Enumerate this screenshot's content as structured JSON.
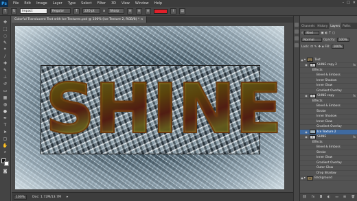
{
  "app": {
    "logo": "Ps",
    "menu": [
      "File",
      "Edit",
      "Image",
      "Layer",
      "Type",
      "Select",
      "Filter",
      "3D",
      "View",
      "Window",
      "Help"
    ],
    "window_controls": [
      "–",
      "□",
      "✕"
    ]
  },
  "options": {
    "font_family": "Impact",
    "font_style": "Regular",
    "font_size": "220 pt",
    "aa_label": "a",
    "antialias": "Sharp"
  },
  "document": {
    "tab_title": "Colorful Translucent Text with Ice Textures.psd @ 100% (Ice Texture 2, RGB/8) *",
    "text": [
      "S",
      "H",
      "I",
      "N",
      "E"
    ],
    "zoom": "100%",
    "doc_size": "Doc: 1.72M/13.7M"
  },
  "panels": {
    "tabs": [
      "Channels",
      "History",
      "Layers",
      "Paths"
    ],
    "active_tab": "Layers",
    "kind": "Kind",
    "blend_mode": "Normal",
    "opacity_label": "Opacity:",
    "opacity": "100%",
    "lock_label": "Lock:",
    "fill_label": "Fill:",
    "fill": "100%",
    "layers": [
      {
        "name": "Text",
        "type": "group",
        "eye": true
      },
      {
        "name": "SHINE copy 2",
        "type": "text",
        "fx": true,
        "eye": true
      },
      {
        "name": "Effects",
        "type": "effects"
      },
      {
        "name": "Bevel & Emboss",
        "type": "effect"
      },
      {
        "name": "Inner Shadow",
        "type": "effect"
      },
      {
        "name": "Inner Glow",
        "type": "effect"
      },
      {
        "name": "Gradient Overlay",
        "type": "effect"
      },
      {
        "name": "SHINE copy",
        "type": "text",
        "fx": true,
        "eye": true
      },
      {
        "name": "Effects",
        "type": "effects"
      },
      {
        "name": "Bevel & Emboss",
        "type": "effect"
      },
      {
        "name": "Stroke",
        "type": "effect"
      },
      {
        "name": "Inner Shadow",
        "type": "effect"
      },
      {
        "name": "Inner Glow",
        "type": "effect"
      },
      {
        "name": "Gradient Overlay",
        "type": "effect"
      },
      {
        "name": "Ice Texture 2",
        "type": "image",
        "selected": true,
        "eye": true
      },
      {
        "name": "SHINE",
        "type": "text",
        "fx": true,
        "eye": true
      },
      {
        "name": "Effects",
        "type": "effects"
      },
      {
        "name": "Bevel & Emboss",
        "type": "effect"
      },
      {
        "name": "Stroke",
        "type": "effect"
      },
      {
        "name": "Inner Glow",
        "type": "effect"
      },
      {
        "name": "Gradient Overlay",
        "type": "effect"
      },
      {
        "name": "Outer Glow",
        "type": "effect"
      },
      {
        "name": "Drop Shadow",
        "type": "effect"
      },
      {
        "name": "Background",
        "type": "group",
        "eye": true
      }
    ],
    "bottom_icons": [
      "link-icon",
      "fx-icon",
      "mask-icon",
      "adjustment-icon",
      "folder-icon",
      "new-layer-icon",
      "trash-icon"
    ]
  },
  "colors": {
    "accent": "#3f6aa0",
    "text_color_swatch": "#e0202a"
  }
}
